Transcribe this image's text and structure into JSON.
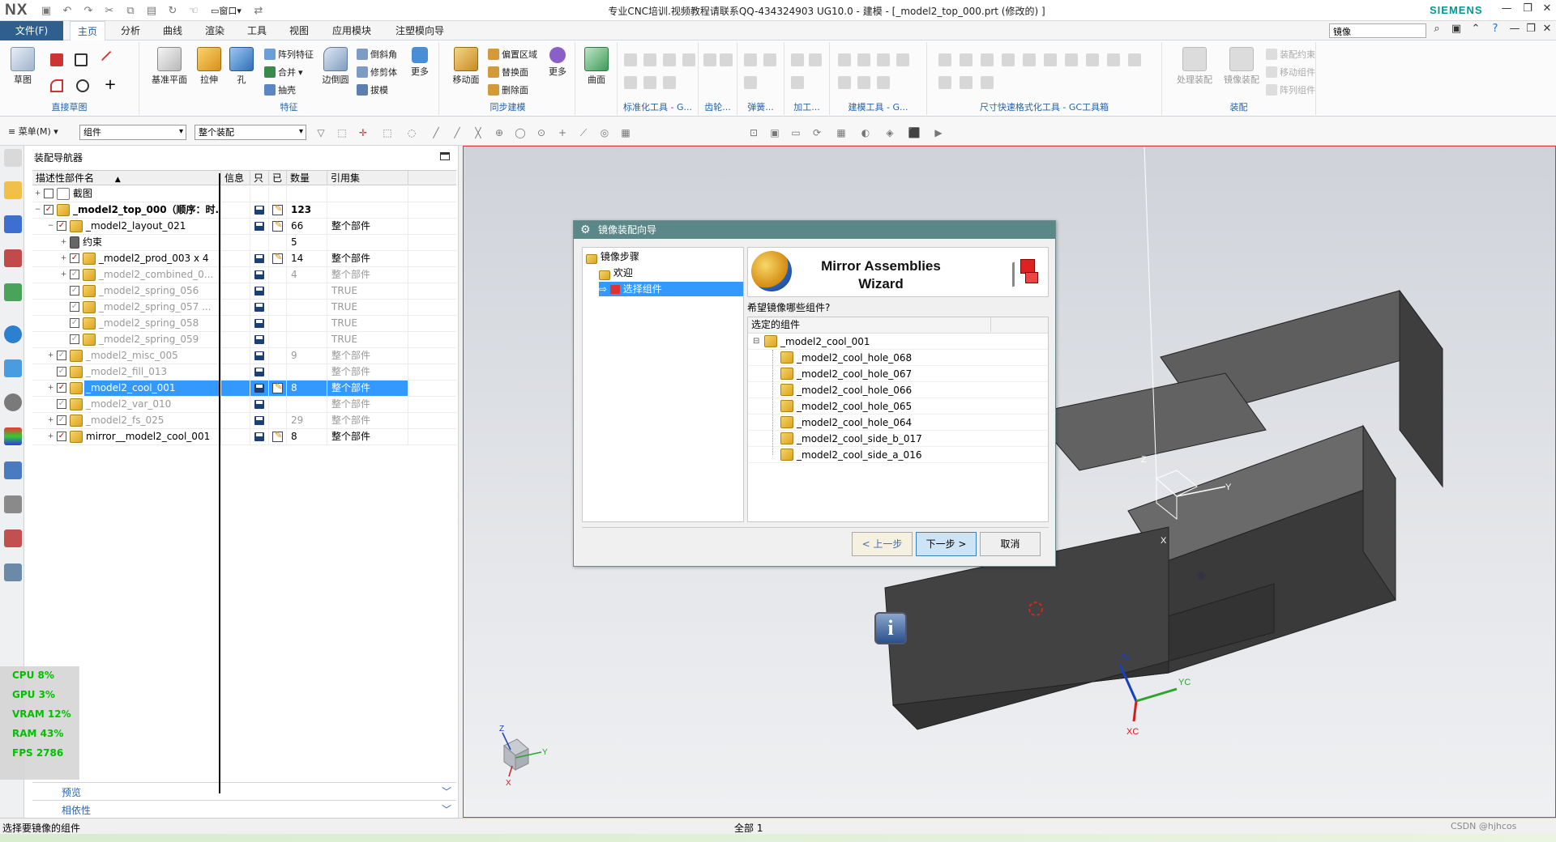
{
  "titlebar": {
    "logo": "NX",
    "title": "专业CNC培训.视频教程请联系QQ-434324903 UG10.0 - 建模 - [_model2_top_000.prt  (修改的) ]",
    "brand": "SIEMENS",
    "window_controls": [
      "minimize-icon",
      "restore-icon",
      "close-icon"
    ]
  },
  "menubar": {
    "file_tab": "文件(F)",
    "tabs": [
      "主页",
      "分析",
      "曲线",
      "渲染",
      "工具",
      "视图",
      "应用模块",
      "注塑模向导"
    ],
    "active_tab": "主页",
    "search_value": "镜像"
  },
  "ribbon": {
    "groups": [
      {
        "label": "直接草图"
      },
      {
        "label": "特征"
      },
      {
        "label": "同步建模"
      },
      {
        "label": "标准化工具 - G..."
      },
      {
        "label": "齿轮..."
      },
      {
        "label": "弹簧..."
      },
      {
        "label": "加工..."
      },
      {
        "label": "建模工具 - G..."
      },
      {
        "label": "尺寸快速格式化工具 - GC工具箱"
      },
      {
        "label": "装配"
      }
    ],
    "sketch_label": "草图",
    "datum_label": "基准平面",
    "extrude_label": "拉伸",
    "hole_label": "孔",
    "pattern_label": "阵列特征",
    "unite_label": "合并",
    "shell_label": "抽壳",
    "edge_blend_label": "边倒圆",
    "chamfer_label": "倒斜角",
    "trim_label": "修剪体",
    "draft_label": "拔模",
    "more1_label": "更多",
    "move_face_label": "移动面",
    "offset_region_label": "偏置区域",
    "replace_face_label": "替换面",
    "delete_face_label": "删除面",
    "more2_label": "更多",
    "surface_label": "曲面",
    "process_asm_label": "处理装配",
    "mirror_asm_label": "镜像装配",
    "asm_constraint_label": "装配约束",
    "move_comp_label": "移动组件",
    "pattern_comp_label": "阵列组件"
  },
  "toolbar2": {
    "menu_label": "菜单(M)",
    "filter_value": "组件",
    "scope_value": "整个装配"
  },
  "navigator": {
    "title": "装配导航器",
    "columns": [
      "描述性部件名",
      "信息",
      "只",
      "已",
      "数量",
      "引用集"
    ],
    "rows": [
      {
        "name": "截图",
        "qty": "",
        "ref": ""
      },
      {
        "name": "_model2_top_000（顺序：时...",
        "qty": "123",
        "ref": ""
      },
      {
        "name": "_model2_layout_021",
        "qty": "66",
        "ref": "整个部件"
      },
      {
        "name": "约束",
        "qty": "5",
        "ref": ""
      },
      {
        "name": "_model2_prod_003 x 4",
        "qty": "14",
        "ref": "整个部件"
      },
      {
        "name": "_model2_combined_0...",
        "qty": "4",
        "ref": "整个部件"
      },
      {
        "name": "_model2_spring_056",
        "qty": "",
        "ref": "TRUE"
      },
      {
        "name": "_model2_spring_057 ...",
        "qty": "",
        "ref": "TRUE"
      },
      {
        "name": "_model2_spring_058",
        "qty": "",
        "ref": "TRUE"
      },
      {
        "name": "_model2_spring_059",
        "qty": "",
        "ref": "TRUE"
      },
      {
        "name": "_model2_misc_005",
        "qty": "9",
        "ref": "整个部件"
      },
      {
        "name": "_model2_fill_013",
        "qty": "",
        "ref": "整个部件"
      },
      {
        "name": "_model2_cool_001",
        "qty": "8",
        "ref": "整个部件"
      },
      {
        "name": "_model2_var_010",
        "qty": "",
        "ref": "整个部件"
      },
      {
        "name": "_model2_fs_025",
        "qty": "29",
        "ref": "整个部件"
      },
      {
        "name": "mirror__model2_cool_001",
        "qty": "8",
        "ref": "整个部件"
      }
    ],
    "footer": [
      "预览",
      "相依性"
    ]
  },
  "perf": {
    "cpu": "CPU   8%",
    "gpu": "GPU   3%",
    "vram": "VRAM  12%",
    "ram": "RAM  43%",
    "fps": "FPS 2786"
  },
  "wizard": {
    "title": "镜像装配向导",
    "steps_root": "镜像步骤",
    "step_welcome": "欢迎",
    "step_select": "选择组件",
    "header_title_line1": "Mirror Assemblies",
    "header_title_line2": "Wizard",
    "question": "希望镜像哪些组件?",
    "list_header": "选定的组件",
    "root_item": "_model2_cool_001",
    "items": [
      "_model2_cool_hole_068",
      "_model2_cool_hole_067",
      "_model2_cool_hole_066",
      "_model2_cool_hole_065",
      "_model2_cool_hole_064",
      "_model2_cool_side_b_017",
      "_model2_cool_side_a_016"
    ],
    "buttons": {
      "back": "< 上一步",
      "next": "下一步 >",
      "cancel": "取消"
    }
  },
  "viewport": {
    "triad_labels": {
      "zc": "ZC",
      "yc": "YC",
      "xc": "XC"
    },
    "csys_labels": {
      "z": "Z",
      "y": "Y",
      "x": "X"
    }
  },
  "statusbar": {
    "left": "选择要镜像的组件",
    "center": "全部 1",
    "right": "CSDN @hjhcos"
  }
}
